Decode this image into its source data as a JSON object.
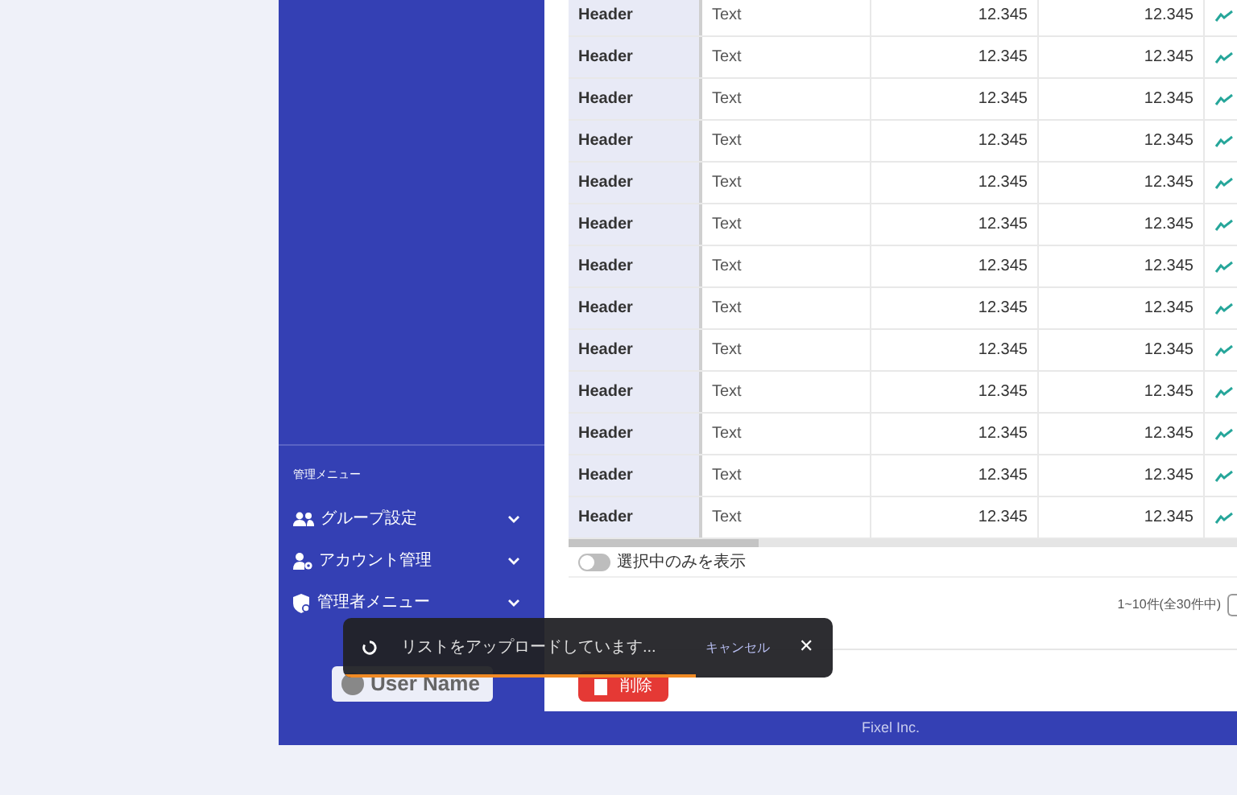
{
  "table": {
    "rows": [
      {
        "header": "Header",
        "text": "Text",
        "value_1": "12.345",
        "value_2": "12.345"
      },
      {
        "header": "Header",
        "text": "Text",
        "value_1": "12.345",
        "value_2": "12.345"
      },
      {
        "header": "Header",
        "text": "Text",
        "value_1": "12.345",
        "value_2": "12.345"
      },
      {
        "header": "Header",
        "text": "Text",
        "value_1": "12.345",
        "value_2": "12.345"
      },
      {
        "header": "Header",
        "text": "Text",
        "value_1": "12.345",
        "value_2": "12.345"
      },
      {
        "header": "Header",
        "text": "Text",
        "value_1": "12.345",
        "value_2": "12.345"
      },
      {
        "header": "Header",
        "text": "Text",
        "value_1": "12.345",
        "value_2": "12.345"
      },
      {
        "header": "Header",
        "text": "Text",
        "value_1": "12.345",
        "value_2": "12.345"
      },
      {
        "header": "Header",
        "text": "Text",
        "value_1": "12.345",
        "value_2": "12.345"
      },
      {
        "header": "Header",
        "text": "Text",
        "value_1": "12.345",
        "value_2": "12.345"
      },
      {
        "header": "Header",
        "text": "Text",
        "value_1": "12.345",
        "value_2": "12.345"
      },
      {
        "header": "Header",
        "text": "Text",
        "value_1": "12.345",
        "value_2": "12.345"
      },
      {
        "header": "Header",
        "text": "Text",
        "value_1": "12.345",
        "value_2": "12.345"
      }
    ]
  },
  "filter_toggle": {
    "label": "選択中のみを表示",
    "on": false
  },
  "pagination": {
    "summary": "1~10件(全30件中)"
  },
  "delete_button": {
    "label": "削除"
  },
  "sidebar": {
    "section_title": "管理メニュー",
    "items": [
      {
        "kind": "group",
        "label": "グループ設定",
        "expanded": false
      },
      {
        "kind": "account",
        "label": "アカウント管理",
        "expanded": false
      },
      {
        "kind": "admin",
        "label": "管理者メニュー",
        "expanded": false
      }
    ],
    "user_button": {
      "label": "User Name"
    }
  },
  "toast": {
    "message": "リストをアップロードしています...",
    "action": "キャンセル",
    "close": "✕",
    "level": 0.72
  },
  "footer": {
    "text": "Fixel Inc."
  }
}
